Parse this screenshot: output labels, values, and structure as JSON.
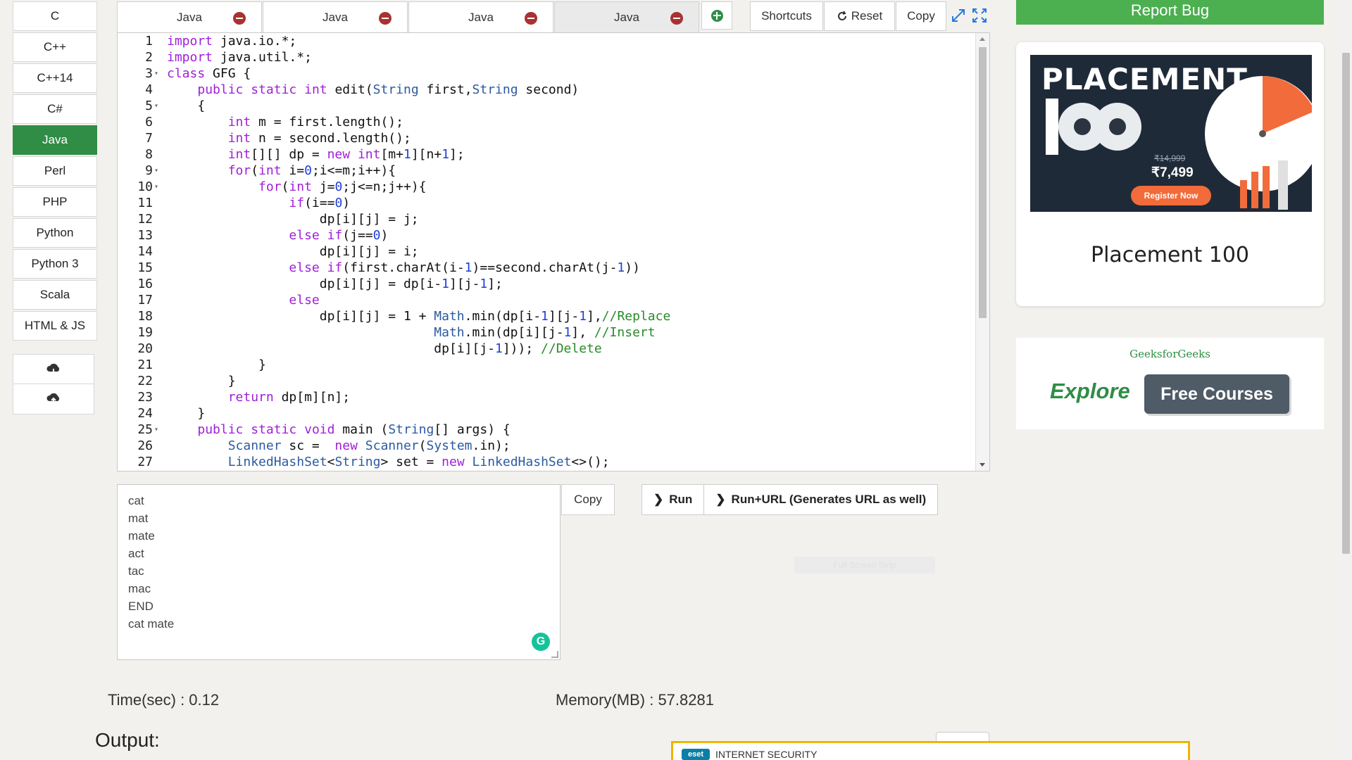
{
  "languages": [
    {
      "label": "C"
    },
    {
      "label": "C++"
    },
    {
      "label": "C++14"
    },
    {
      "label": "C#"
    },
    {
      "label": "Java",
      "active": true
    },
    {
      "label": "Perl"
    },
    {
      "label": "PHP"
    },
    {
      "label": "Python"
    },
    {
      "label": "Python 3"
    },
    {
      "label": "Scala"
    },
    {
      "label": "HTML & JS"
    }
  ],
  "cloud": {
    "download_icon": "cloud-download-icon",
    "upload_icon": "cloud-upload-icon"
  },
  "tabs": [
    {
      "label": "Java"
    },
    {
      "label": "Java"
    },
    {
      "label": "Java"
    },
    {
      "label": "Java",
      "active": true
    }
  ],
  "toolbar": {
    "shortcuts_label": "Shortcuts",
    "reset_label": "Reset",
    "copy_label": "Copy"
  },
  "code_lines": [
    "import java.io.*;",
    "import java.util.*;",
    "class GFG {",
    "    public static int edit(String first,String second)",
    "    {",
    "        int m = first.length();",
    "        int n = second.length();",
    "        int[][] dp = new int[m+1][n+1];",
    "        for(int i=0;i<=m;i++){",
    "            for(int j=0;j<=n;j++){",
    "                if(i==0)",
    "                    dp[i][j] = j;",
    "                else if(j==0)",
    "                    dp[i][j] = i;",
    "                else if(first.charAt(i-1)==second.charAt(j-1))",
    "                    dp[i][j] = dp[i-1][j-1];",
    "                else",
    "                    dp[i][j] = 1 + Math.min(dp[i-1][j-1],//Replace",
    "                                   Math.min(dp[i][j-1], //Insert",
    "                                   dp[i][j-1])); //Delete",
    "            }",
    "        }",
    "        return dp[m][n];",
    "    }",
    "    public static void main (String[] args) {",
    "        Scanner sc =  new Scanner(System.in);",
    "        LinkedHashSet<String> set = new LinkedHashSet<>();"
  ],
  "fold_lines": [
    3,
    5,
    9,
    10,
    25
  ],
  "input_lines": [
    "cat",
    "mat",
    "mate",
    "act",
    "tac",
    "mac",
    "END",
    "cat mate"
  ],
  "input_copy_label": "Copy",
  "run": {
    "run_label": "Run",
    "run_url_label": "Run+URL (Generates URL as well)"
  },
  "fullscreen_strip": "Full Screen Strip",
  "stats": {
    "time": "Time(sec) : 0.12",
    "memory": "Memory(MB) : 57.8281"
  },
  "output_label": "Output:",
  "right": {
    "report_bug": "Report Bug",
    "banner_title": "PLACEMENT",
    "banner_number": "100",
    "price_old": "₹14,999",
    "price_new": "₹7,499",
    "register": "Register Now",
    "card_title": "Placement 100",
    "ad_brand": "GeeksforGeeks",
    "ad_explore": "Explore",
    "ad_button": "Free Courses"
  },
  "eset": {
    "logo": "eset",
    "text": "INTERNET SECURITY"
  },
  "colors": {
    "active_green": "#2f8d46",
    "report_green": "#4caf50",
    "close_red": "#a83232",
    "orange": "#f26b3a"
  }
}
